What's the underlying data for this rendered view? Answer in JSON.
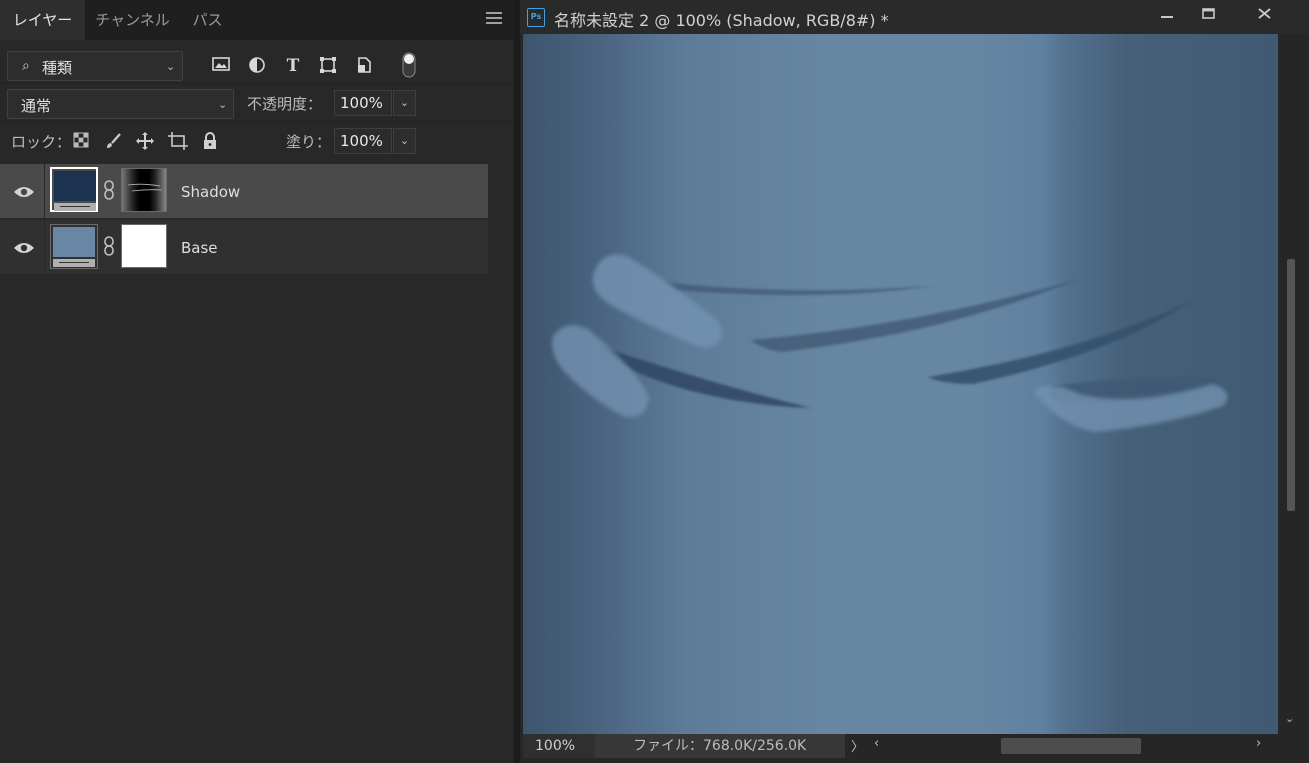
{
  "layers_panel": {
    "tabs": [
      {
        "label": "レイヤー"
      },
      {
        "label": "チャンネル"
      },
      {
        "label": "パス"
      }
    ],
    "filter": {
      "label": "種類",
      "icon": "search-icon"
    },
    "filter_icons": [
      "image-filter-icon",
      "adjustment-filter-icon",
      "type-filter-icon",
      "shape-filter-icon",
      "smart-object-filter-icon",
      "filter-toggle-icon"
    ],
    "blend_mode": "通常",
    "opacity_label": "不透明度：",
    "opacity_value": "100%",
    "lock_label": "ロック：",
    "lock_icons": [
      "lock-transparent-icon",
      "lock-paint-icon",
      "lock-position-icon",
      "lock-artboard-icon",
      "lock-all-icon"
    ],
    "fill_label": "塗り：",
    "fill_value": "100%",
    "layers": [
      {
        "name": "Shadow",
        "selected": true,
        "color": "#1c3350"
      },
      {
        "name": "Base",
        "selected": false,
        "color": "#6986a4"
      }
    ]
  },
  "document": {
    "title": "名称未設定 2 @ 100% (Shadow, RGB/8#) *",
    "app_icon": "Ps",
    "window_controls": [
      "minimize-icon",
      "maximize-icon",
      "close-icon"
    ]
  },
  "status": {
    "zoom": "100%",
    "file_info": "ファイル：768.0K/256.0K"
  },
  "colors": {
    "canvas_base": "#6786a2",
    "canvas_edge": "#3d546d",
    "shadow_stroke": "#3e5670",
    "highlight_stroke": "#7392b0"
  }
}
